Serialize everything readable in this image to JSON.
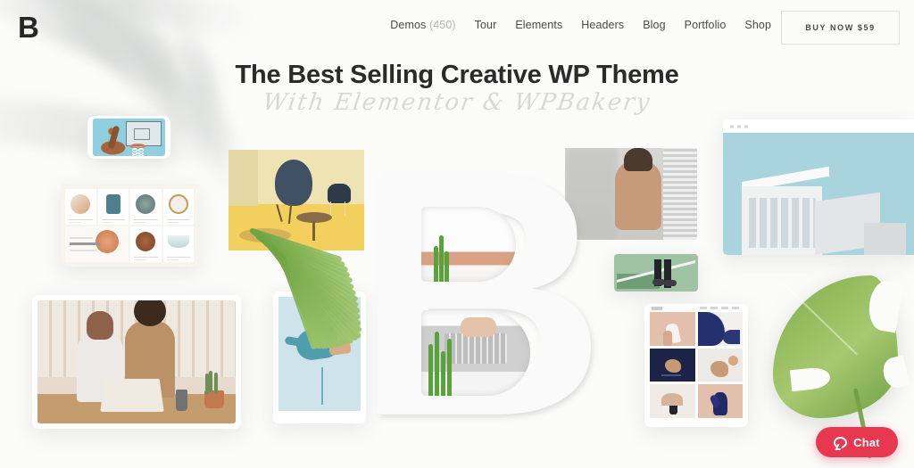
{
  "header": {
    "logo": "B",
    "nav": [
      {
        "label": "Demos",
        "count": "(450)"
      },
      {
        "label": "Tour"
      },
      {
        "label": "Elements"
      },
      {
        "label": "Headers"
      },
      {
        "label": "Blog"
      },
      {
        "label": "Portfolio"
      },
      {
        "label": "Shop"
      }
    ],
    "buy_button": "BUY NOW $59"
  },
  "hero": {
    "title": "The Best Selling Creative WP Theme",
    "subtitle": "With Elementor & WPBakery"
  },
  "showcase": {
    "phone_basketball": "basketball dunk phone mockup",
    "shop_grid": "ceramics shop grid mockup",
    "laptop": "two people working at laptop photo",
    "interior": "yellow interior with designer chairs",
    "tablet_hand": "blue painted hand tablet mockup",
    "big_letter": "B",
    "photo_back": "portrait photo of person facing wall",
    "photo_court": "green tennis court with sneakers",
    "browser": "browser mockup with modern architecture",
    "tablet_portfolio": "tablet portfolio grid mockup",
    "monstera": "monstera leaf"
  },
  "chat": {
    "label": "Chat",
    "color": "#e8384f"
  },
  "colors": {
    "background": "#fbfbfa",
    "text": "#2b2b2b",
    "nav_text": "#4a4a4a",
    "muted": "#b6b6b6",
    "subtitle": "#d8d8d8",
    "accent": "#e8384f"
  }
}
